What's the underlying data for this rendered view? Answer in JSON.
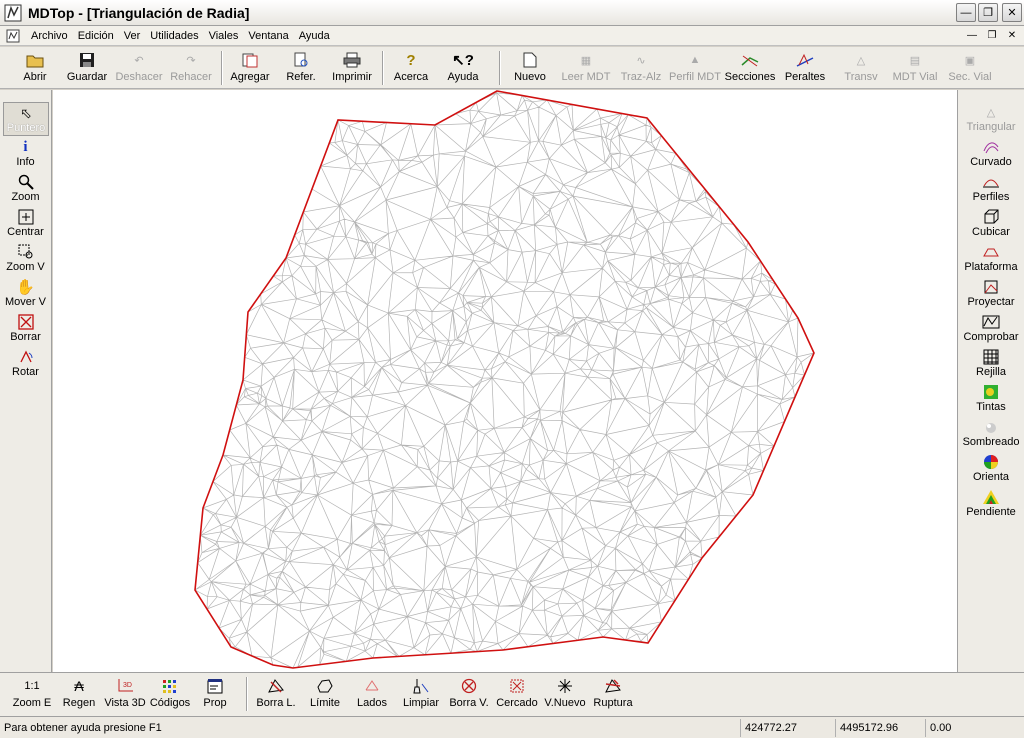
{
  "window": {
    "title": "MDTop - [Triangulación de Radia]"
  },
  "menu": [
    {
      "label": "Archivo",
      "name": "menu-archivo"
    },
    {
      "label": "Edición",
      "name": "menu-edicion"
    },
    {
      "label": "Ver",
      "name": "menu-ver"
    },
    {
      "label": "Utilidades",
      "name": "menu-utilidades"
    },
    {
      "label": "Viales",
      "name": "menu-viales"
    },
    {
      "label": "Ventana",
      "name": "menu-ventana"
    },
    {
      "label": "Ayuda",
      "name": "menu-ayuda"
    }
  ],
  "toolbar": {
    "abrir": "Abrir",
    "guardar": "Guardar",
    "deshacer": "Deshacer",
    "rehacer": "Rehacer",
    "agregar": "Agregar",
    "refer": "Refer.",
    "imprimir": "Imprimir",
    "acerca": "Acerca",
    "ayuda": "Ayuda",
    "nuevo": "Nuevo",
    "leer_mdt": "Leer MDT",
    "traz_alz": "Traz-Alz",
    "perfil_mdt": "Perfil MDT",
    "secciones": "Secciones",
    "peraltes": "Peraltes",
    "transv": "Transv",
    "mdt_vial": "MDT Vial",
    "sec_vial": "Sec. Vial"
  },
  "left_tools": {
    "puntero": "Puntero",
    "info": "Info",
    "zoom": "Zoom",
    "centrar": "Centrar",
    "zoom_v": "Zoom V",
    "mover_v": "Mover V",
    "borrar": "Borrar",
    "rotar": "Rotar"
  },
  "right_tools": {
    "triangular": "Triangular",
    "curvado": "Curvado",
    "perfiles": "Perfiles",
    "cubicar": "Cubicar",
    "plataforma": "Plataforma",
    "proyectar": "Proyectar",
    "comprobar": "Comprobar",
    "rejilla": "Rejilla",
    "tintas": "Tintas",
    "sombreado": "Sombreado",
    "orienta": "Orienta",
    "pendiente": "Pendiente"
  },
  "bottom_tools": {
    "zoom_e_icon": "1:1",
    "zoom_e": "Zoom E",
    "regen": "Regen",
    "vista3d": "Vista 3D",
    "codigos": "Códigos",
    "prop": "Prop",
    "borra_l": "Borra L.",
    "limite": "Límite",
    "lados": "Lados",
    "limpiar": "Limpiar",
    "borra_v": "Borra V.",
    "cercado": "Cercado",
    "v_nuevo": "V.Nuevo",
    "ruptura": "Ruptura"
  },
  "status": {
    "help": "Para obtener ayuda presione F1",
    "x": "424772.27",
    "y": "4495172.96",
    "z": "0.00"
  },
  "colors": {
    "mesh": "#b4b4b4",
    "boundary": "#d01010",
    "accent": "#c00000"
  }
}
